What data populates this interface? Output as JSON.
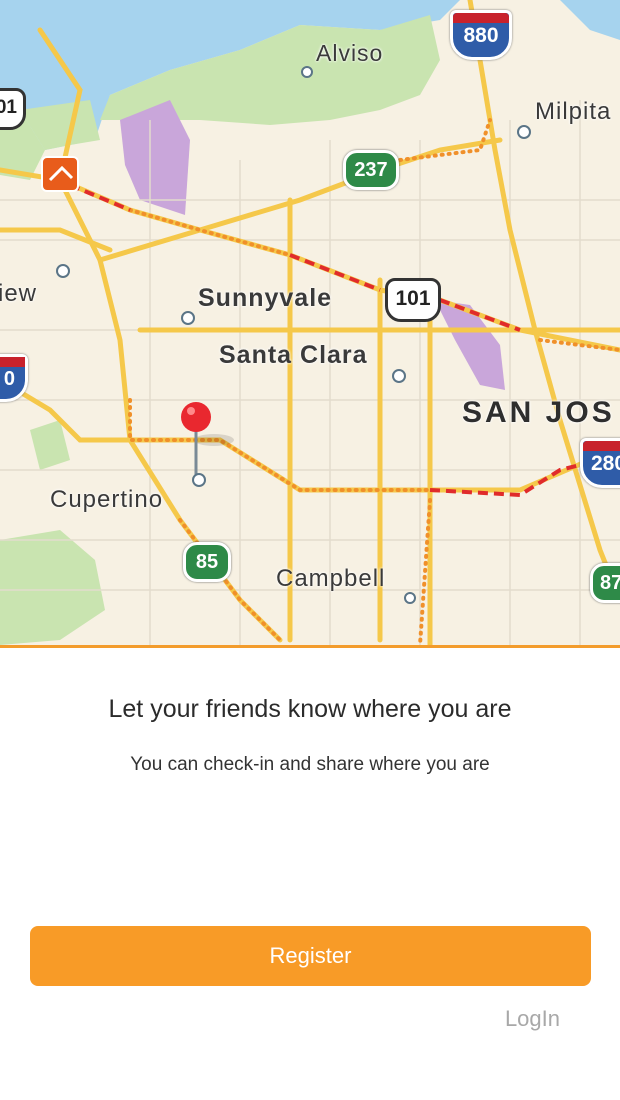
{
  "map": {
    "place_labels": {
      "alviso": "Alviso",
      "milpitas": "Milpita",
      "view": "iew",
      "sunnyvale": "Sunnyvale",
      "santa_clara": "Santa Clara",
      "san_jose": "SAN JOS",
      "cupertino": "Cupertino",
      "campbell": "Campbell"
    },
    "shields": {
      "i880": "880",
      "i280": "280",
      "us101_left": "01",
      "us101": "101",
      "ca237": "237",
      "ca85": "85",
      "ca87": "87",
      "left_edge": "0"
    },
    "colors": {
      "water": "#a6d3ee",
      "park": "#c9e4b0",
      "land": "#f7f1e3",
      "road": "#f5c84a",
      "traffic_jam": "#e02b2b",
      "pin": "#e9282f",
      "accent": "#f89b27"
    }
  },
  "onboarding": {
    "title": "Let your friends know where you are",
    "subtitle": "You can check-in and share where you are",
    "register_label": "Register",
    "login_label": "LogIn"
  }
}
